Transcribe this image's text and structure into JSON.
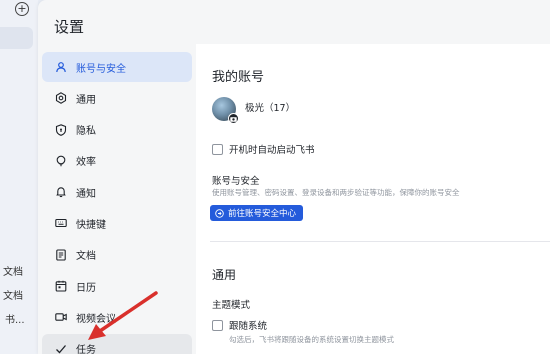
{
  "background_app": {
    "left_texts": [
      "文档",
      "文档",
      "书..."
    ]
  },
  "window": {
    "title": "设置"
  },
  "nav": {
    "items": [
      {
        "label": "账号与安全",
        "icon": "user-icon",
        "state": "active"
      },
      {
        "label": "通用",
        "icon": "gear-icon",
        "state": ""
      },
      {
        "label": "隐私",
        "icon": "shield-icon",
        "state": ""
      },
      {
        "label": "效率",
        "icon": "lightbulb-icon",
        "state": ""
      },
      {
        "label": "通知",
        "icon": "bell-icon",
        "state": ""
      },
      {
        "label": "快捷键",
        "icon": "keyboard-icon",
        "state": ""
      },
      {
        "label": "文档",
        "icon": "document-icon",
        "state": ""
      },
      {
        "label": "日历",
        "icon": "calendar-icon",
        "state": ""
      },
      {
        "label": "视频会议",
        "icon": "video-icon",
        "state": ""
      },
      {
        "label": "任务",
        "icon": "check-task-icon",
        "state": "hover"
      }
    ]
  },
  "content": {
    "my_account_heading": "我的账号",
    "user_name": "极光（17）",
    "auto_start_label": "开机时自动启动飞书",
    "account_security_title": "账号与安全",
    "account_security_desc": "使用账号管理、密码设置、登录设备和两步验证等功能，保障你的账号安全",
    "goto_security_button": "前往账号安全中心",
    "general_heading": "通用",
    "theme_mode_title": "主题模式",
    "follow_system_label": "跟随系统",
    "follow_system_desc": "勾选后，飞书将跟随设备的系统设置切换主题模式"
  },
  "colors": {
    "accent": "#245bdb",
    "active_nav_bg": "#dce6f8",
    "annotation_arrow": "#d9302c"
  }
}
